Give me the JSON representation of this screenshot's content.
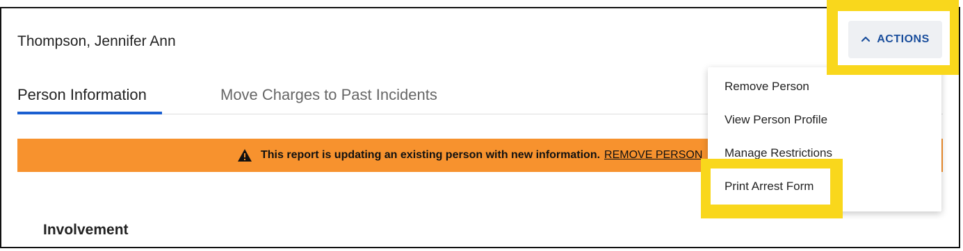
{
  "person": {
    "name": "Thompson, Jennifer Ann"
  },
  "tabs": [
    {
      "label": "Person Information",
      "active": true
    },
    {
      "label": "Move Charges to Past Incidents",
      "active": false
    }
  ],
  "banner": {
    "icon": "warning-icon",
    "message": "This report is updating an existing person with new information.",
    "link": "REMOVE PERSON",
    "color": "#f7922e"
  },
  "section": {
    "title": "Involvement"
  },
  "actions": {
    "label": "ACTIONS",
    "icon": "chevron-up-icon",
    "menu": [
      "Remove Person",
      "View Person Profile",
      "Manage Restrictions",
      "Print Arrest Form"
    ]
  },
  "colors": {
    "accent": "#1a5fd0",
    "actions_text": "#1a4e9c",
    "highlight": "#f9d71c"
  }
}
